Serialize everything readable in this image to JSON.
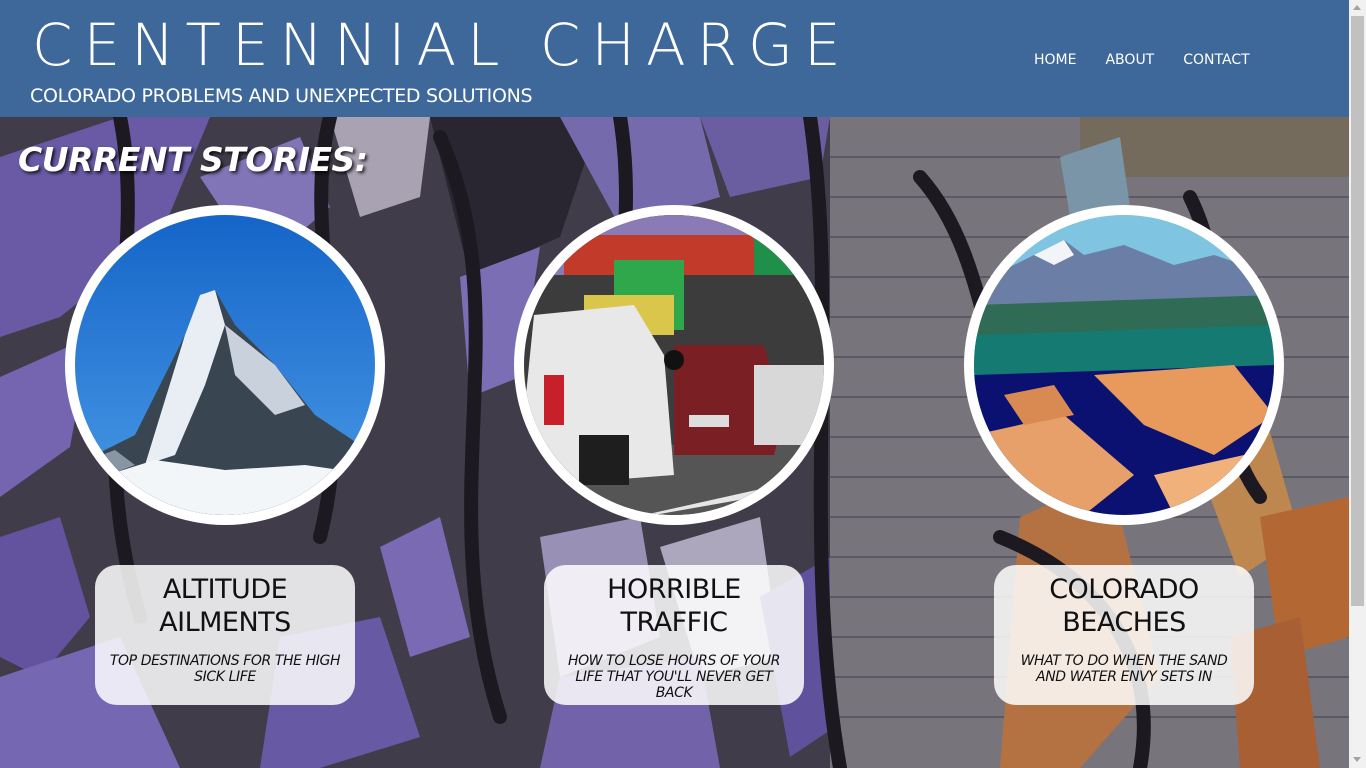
{
  "header": {
    "title": "CENTENNIAL CHARGE",
    "subtitle": "COLORADO PROBLEMS AND UNEXPECTED SOLUTIONS"
  },
  "nav": {
    "items": [
      {
        "label": "HOME"
      },
      {
        "label": "ABOUT"
      },
      {
        "label": "CONTACT"
      }
    ]
  },
  "main": {
    "heading": "CURRENT STORIES:",
    "stories": [
      {
        "title_line1": "ALTITUDE",
        "title_line2": "AILMENTS",
        "description": "TOP DESTINATIONS FOR THE HIGH SICK LIFE",
        "image": "mountain-peak-photo"
      },
      {
        "title_line1": "HORRIBLE",
        "title_line2": "TRAFFIC",
        "description": "HOW TO LOSE HOURS OF YOUR LIFE THAT YOU'LL NEVER GET BACK",
        "image": "highway-traffic-photo"
      },
      {
        "title_line1": "COLORADO",
        "title_line2": "BEACHES",
        "description": "WHAT TO DO WHEN THE SAND AND WATER ENVY SETS IN",
        "image": "sand-dunes-photo"
      }
    ]
  },
  "colors": {
    "header_bg": "#3d6899",
    "text": "#ffffff",
    "card_bg": "rgba(255,255,255,0.85)"
  }
}
